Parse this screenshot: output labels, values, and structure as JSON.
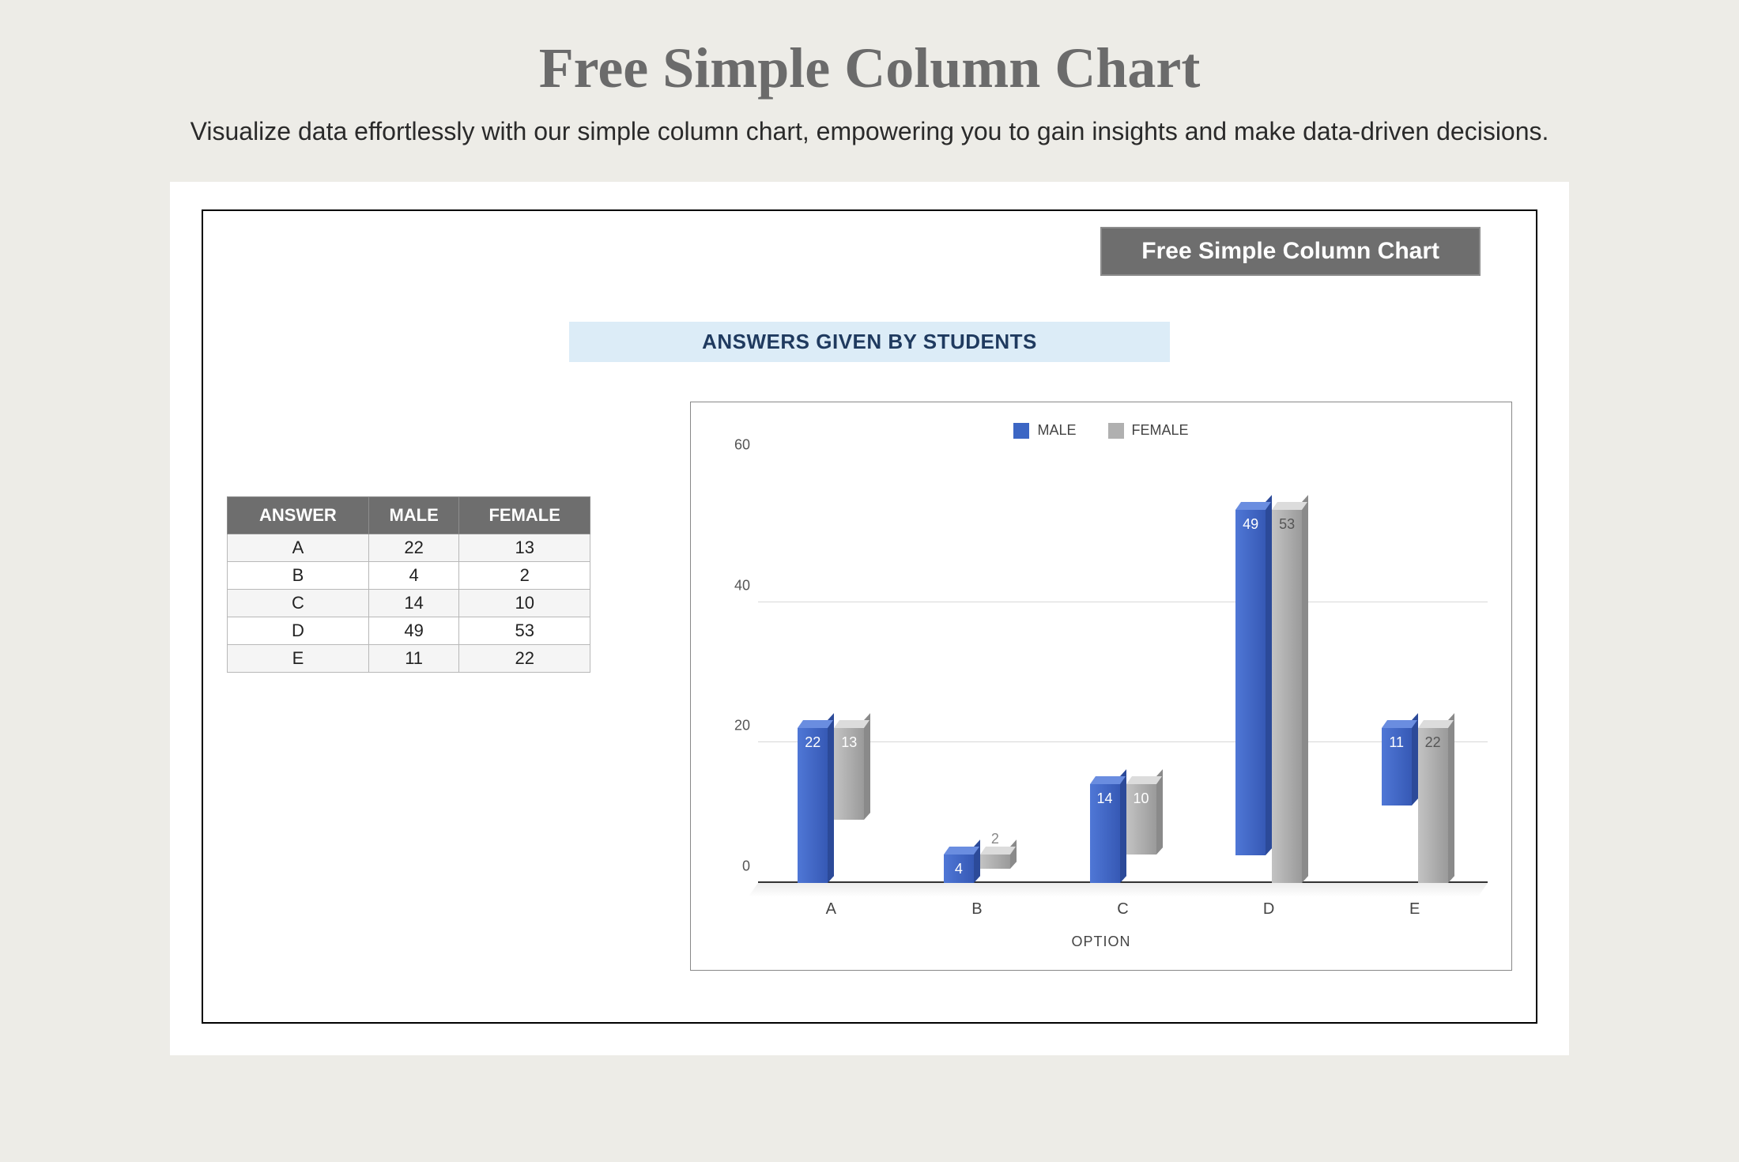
{
  "page": {
    "title": "Free Simple Column Chart",
    "subtitle": "Visualize data effortlessly with our simple column chart, empowering you to gain insights and make data-driven decisions."
  },
  "banner": {
    "label": "Free Simple Column Chart"
  },
  "chart_subtitle": "ANSWERS GIVEN BY STUDENTS",
  "table": {
    "headers": {
      "c0": "ANSWER",
      "c1": "MALE",
      "c2": "FEMALE"
    },
    "rows": [
      {
        "answer": "A",
        "male": "22",
        "female": "13"
      },
      {
        "answer": "B",
        "male": "4",
        "female": "2"
      },
      {
        "answer": "C",
        "male": "14",
        "female": "10"
      },
      {
        "answer": "D",
        "male": "49",
        "female": "53"
      },
      {
        "answer": "E",
        "male": "11",
        "female": "22"
      }
    ]
  },
  "legend": {
    "male": "MALE",
    "female": "FEMALE"
  },
  "yticks": {
    "t0": "0",
    "t20": "20",
    "t40": "40",
    "t60": "60"
  },
  "xlabel": "OPTION",
  "chart_data": {
    "type": "bar",
    "title": "ANSWERS GIVEN BY STUDENTS",
    "xlabel": "OPTION",
    "ylabel": "",
    "ylim": [
      0,
      60
    ],
    "categories": [
      "A",
      "B",
      "C",
      "D",
      "E"
    ],
    "series": [
      {
        "name": "MALE",
        "values": [
          22,
          4,
          14,
          49,
          11
        ],
        "color": "#3c66c4"
      },
      {
        "name": "FEMALE",
        "values": [
          13,
          2,
          10,
          53,
          22
        ],
        "color": "#b0b0b0"
      }
    ],
    "legend_position": "top",
    "grid": true
  }
}
